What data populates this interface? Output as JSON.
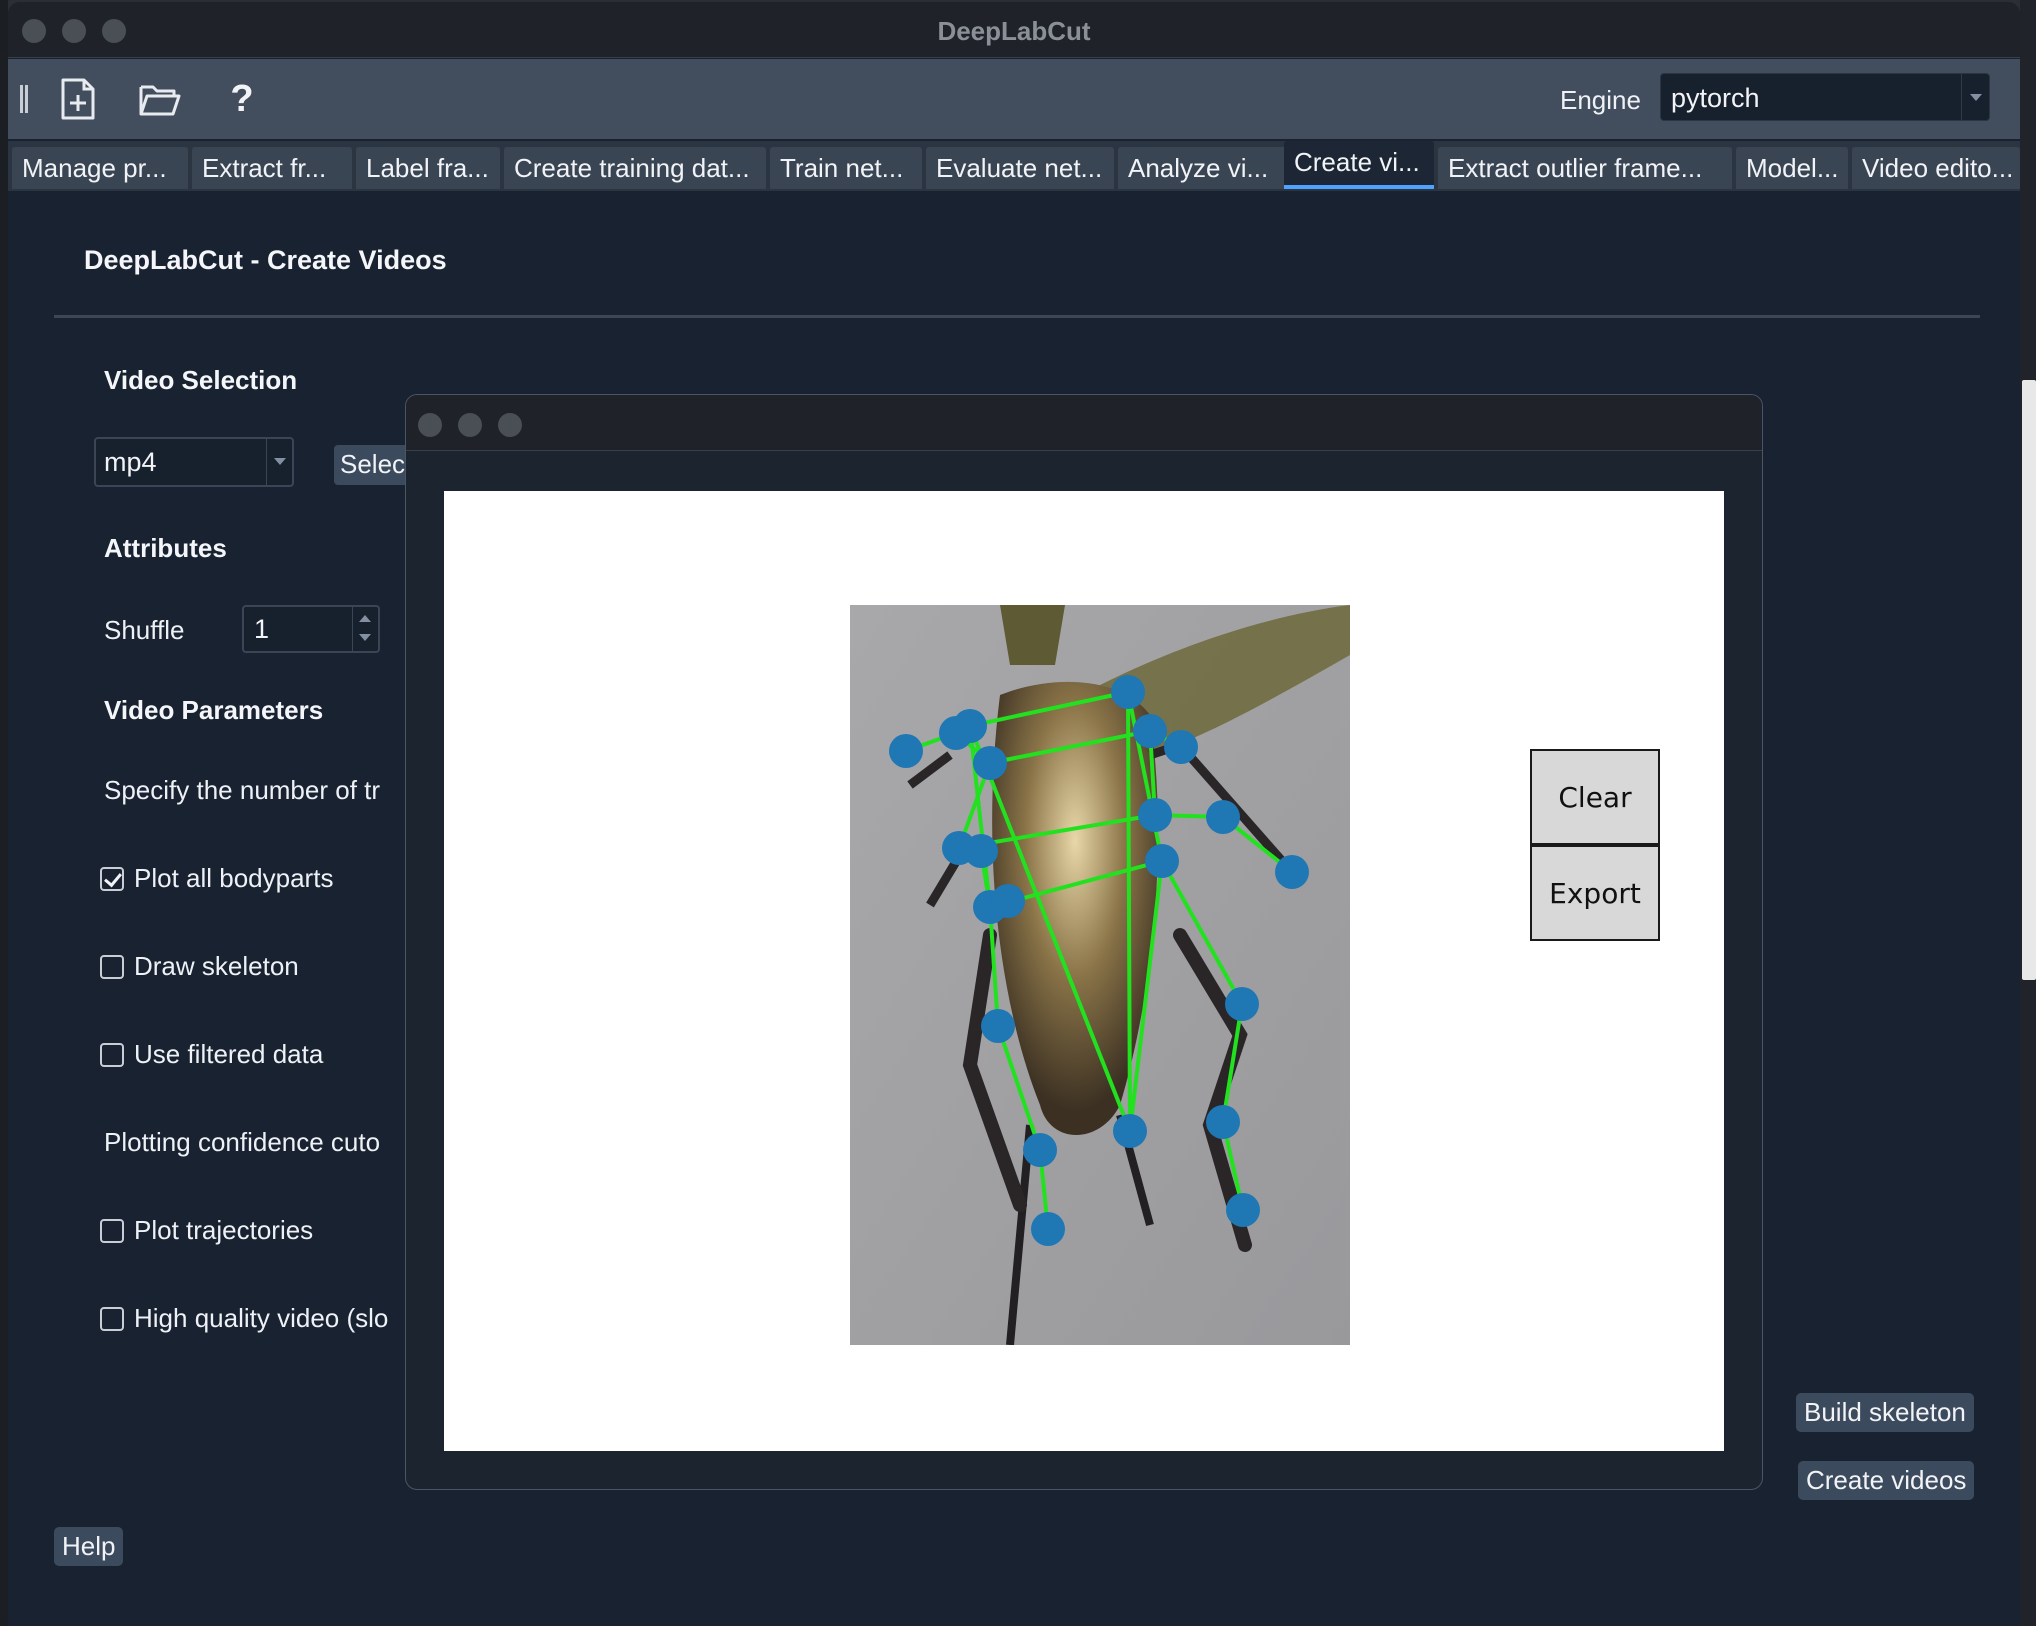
{
  "window": {
    "title": "DeepLabCut"
  },
  "toolbar": {
    "new_icon": "new-project-icon",
    "open_icon": "folder-open-icon",
    "help_icon": "help-icon",
    "help_glyph": "?",
    "engine_label": "Engine",
    "engine_value": "pytorch"
  },
  "tabs": [
    "Manage pr...",
    "Extract fr...",
    "Label fra...",
    "Create training dat...",
    "Train net...",
    "Evaluate net...",
    "Analyze vi...",
    "Create vi...",
    "Extract outlier frame...",
    "Model...",
    "Video edito..."
  ],
  "active_tab": "Create vi...",
  "panel": {
    "title": "DeepLabCut - Create Videos",
    "video_selection": {
      "heading": "Video Selection",
      "format_value": "mp4",
      "select_button": "Selec"
    },
    "attributes": {
      "heading": "Attributes",
      "shuffle_label": "Shuffle",
      "shuffle_value": "1"
    },
    "video_parameters": {
      "heading": "Video Parameters",
      "num_tracks_label": "Specify the number of tr",
      "plot_all_bodyparts": {
        "label": "Plot all bodyparts",
        "checked": true
      },
      "draw_skeleton": {
        "label": "Draw skeleton",
        "checked": false
      },
      "use_filtered_data": {
        "label": "Use filtered data",
        "checked": false
      },
      "cutoff_label": "Plotting confidence cuto",
      "plot_trajectories": {
        "label": "Plot trajectories",
        "checked": false
      },
      "high_quality": {
        "label": "High quality video (slo",
        "checked": false
      }
    },
    "build_skeleton_button": "Build skeleton",
    "create_videos_button": "Create videos",
    "help_button": "Help"
  },
  "skeleton_window": {
    "clear_button": "Clear",
    "export_button": "Export",
    "colors": {
      "keypoint": "#1f77b4",
      "bone": "#22e11f"
    }
  }
}
